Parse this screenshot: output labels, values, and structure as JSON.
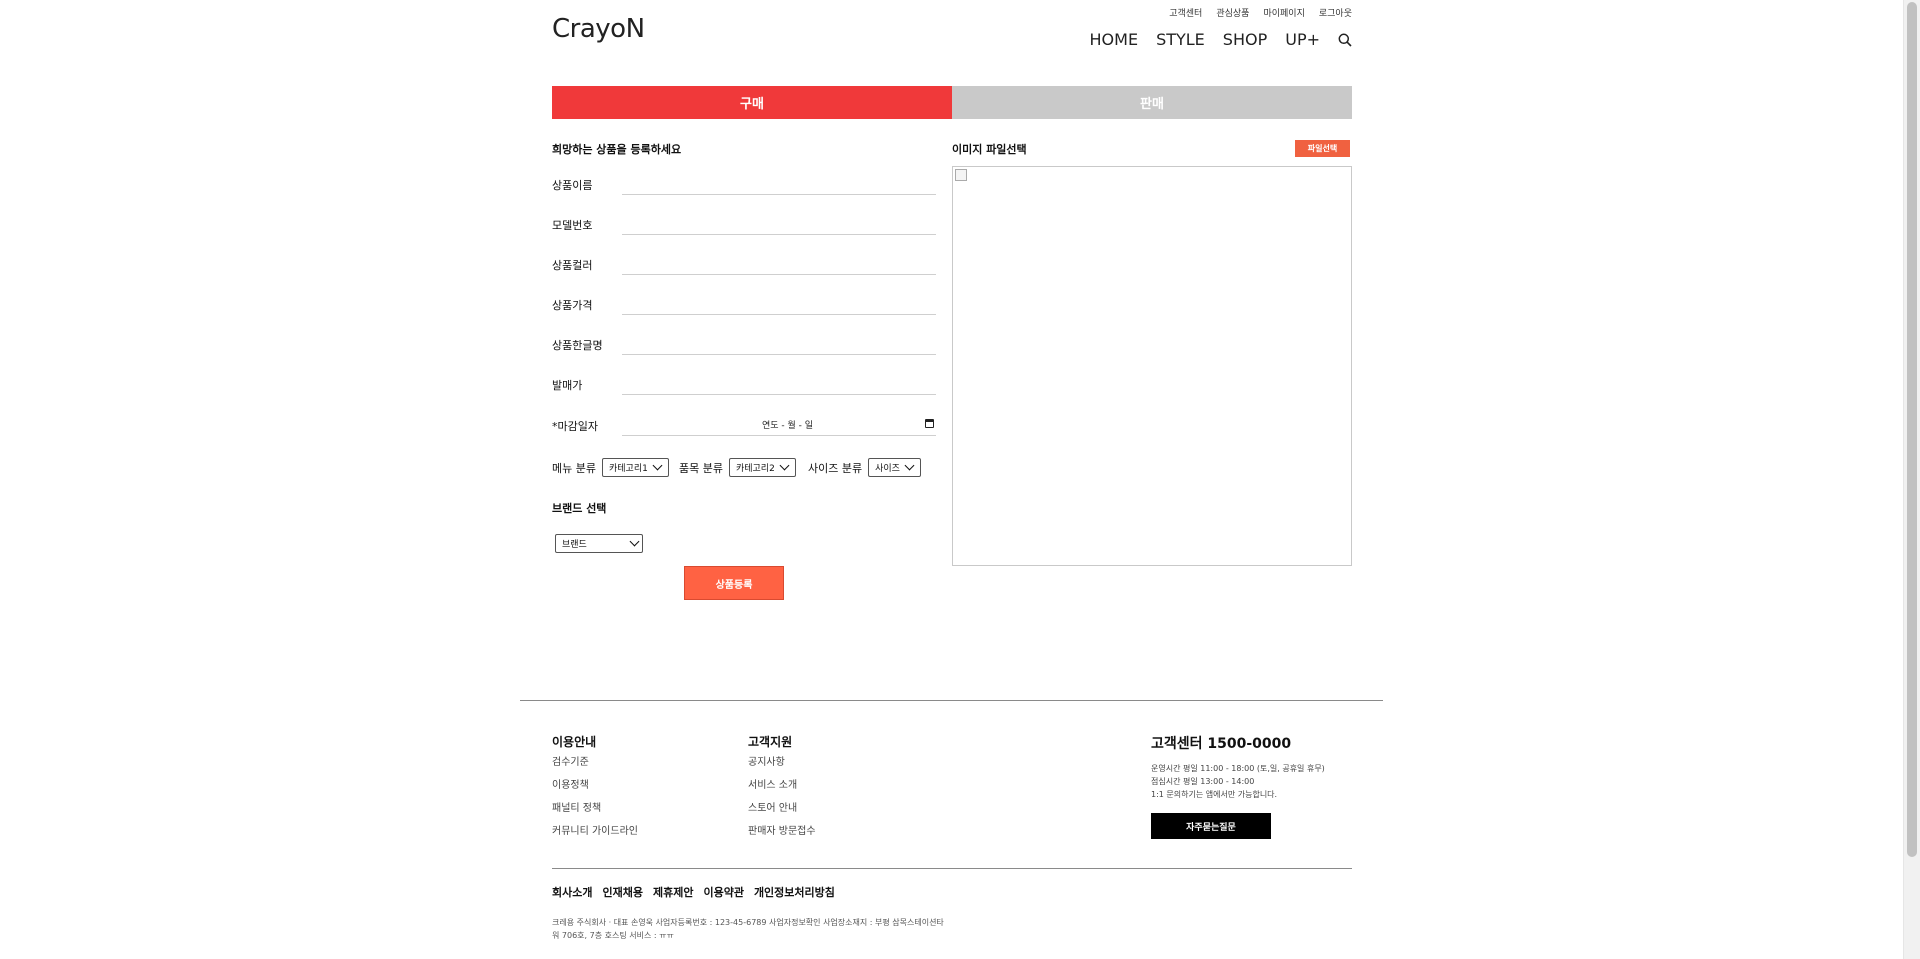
{
  "header": {
    "logo": "CrayoN",
    "util_links": [
      "고객센터",
      "관심상품",
      "마이페이지",
      "로그아웃"
    ],
    "nav": [
      "HOME",
      "STYLE",
      "SHOP",
      "UP+"
    ]
  },
  "tabs": {
    "buy": "구매",
    "sell": "판매"
  },
  "form": {
    "title": "희망하는 상품을 등록하세요",
    "fields": [
      "상품이름",
      "모델번호",
      "상품컬러",
      "상품가격",
      "상품한글명",
      "발매가"
    ],
    "deadline_label": "*마감일자",
    "deadline_placeholder": "연도 - 월 - 일",
    "menu_label": "메뉴 분류",
    "menu_value": "카테고리1",
    "item_label": "품목 분류",
    "item_value": "카테고리2",
    "size_label": "사이즈 분류",
    "size_value": "사이즈",
    "brand_label": "브랜드 선택",
    "brand_value": "브랜드",
    "submit": "상품등록"
  },
  "image": {
    "title": "이미지 파일선택",
    "button": "파일선택"
  },
  "footer": {
    "guide_title": "이용안내",
    "guide_links": [
      "검수기준",
      "이용정책",
      "패널티 정책",
      "커뮤니티 가이드라인"
    ],
    "support_title": "고객지원",
    "support_links": [
      "공지사항",
      "서비스 소개",
      "스토어 안내",
      "판매자 방문접수"
    ],
    "cs_title": "고객센터 1500-0000",
    "cs_info": [
      "운영시간 평일 11:00 - 18:00 (토,일, 공휴일 휴무)",
      "점심시간 평일 13:00 - 14:00",
      "1:1 문의하기는 앱에서만 가능합니다."
    ],
    "faq": "자주묻는질문",
    "bottom_links": [
      "회사소개",
      "인재채용",
      "제휴제안",
      "이용약관",
      "개인정보처리방침"
    ],
    "company_line1": "크레용 주식회사 · 대표 손영욱   사업자등록번호 : 123-45-6789   사업자정보확인   사업장소재지 : 부평 삼목스테이션타",
    "company_line2": "워 706호, 7층   호스팅 서비스 : ㅠㅠ"
  }
}
